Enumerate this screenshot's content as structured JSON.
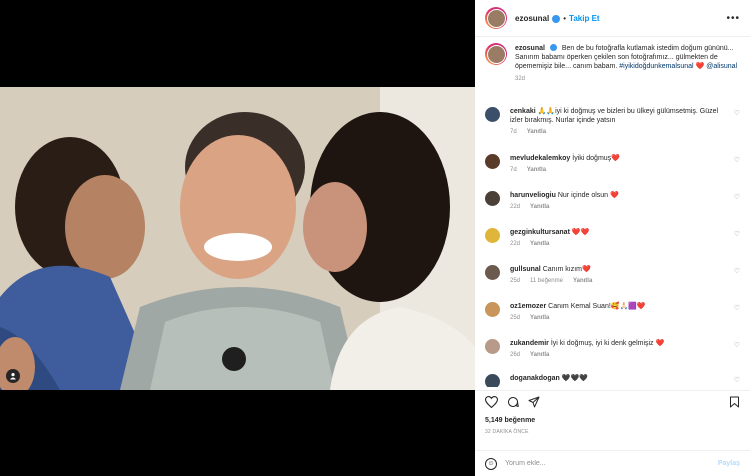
{
  "post": {
    "username": "ezosunal",
    "follow_label": "Takip Et",
    "dot": "•",
    "more": "•••"
  },
  "caption": {
    "username": "ezosunal",
    "text": "Ben de bu fotoğrafla kutlamak istedim doğum gününü... Sanırım babamı öperken çekilen son fotoğrafımız... gülmekten de öpememişiz bile... canım babam.",
    "hashtag": "#iyikidoğdunkemalsunal",
    "heart": "❤️",
    "mention": "@alisunal",
    "time": "32d"
  },
  "comments": [
    {
      "username": "cenkaki",
      "text": "🙏🙏iyi ki doğmuş ve bizleri bu ülkeyi gülümsetmiş. Güzel izler bırakmış. Nurlar içinde yatsın",
      "time": "7d",
      "reply": "Yanıtla",
      "likes": "",
      "avatar_color": "#3c4f6a"
    },
    {
      "username": "mevludekalemkoy",
      "text": "İyiki doğmuş❤️",
      "time": "7d",
      "reply": "Yanıtla",
      "likes": "",
      "avatar_color": "#5a3b2a"
    },
    {
      "username": "harunveliogiu",
      "text": "Nur içinde olsun ❤️",
      "time": "22d",
      "reply": "Yanıtla",
      "likes": "",
      "avatar_color": "#4a4038"
    },
    {
      "username": "gezginkultursanat",
      "text": "❤️❤️",
      "time": "22d",
      "reply": "Yanıtla",
      "likes": "",
      "avatar_color": "#e0b63a"
    },
    {
      "username": "gullsunal",
      "text": "Canım kızım❤️",
      "time": "25d",
      "reply": "Yanıtla",
      "likes": "11 beğenme",
      "avatar_color": "#6d5a4f"
    },
    {
      "username": "oz1emozer",
      "text": "Canım Kemal Suan!🥰🙏🏻🟪❤️",
      "time": "25d",
      "reply": "Yanıtla",
      "likes": "",
      "avatar_color": "#c8955a"
    },
    {
      "username": "zukandemir",
      "text": "İyi ki doğmuş, iyi ki denk gelmişiz ❤️",
      "time": "26d",
      "reply": "Yanıtla",
      "likes": "",
      "avatar_color": "#b89a8a"
    },
    {
      "username": "doganakdogan",
      "text": "🖤🖤🖤",
      "time": "",
      "reply": "",
      "likes": "",
      "avatar_color": "#3a4a5a"
    }
  ],
  "actions": {
    "likes": "5,149 beğenme",
    "ago": "32 DAKİKA ÖNCE"
  },
  "add_comment": {
    "placeholder": "Yorum ekle...",
    "share_label": "Paylaş",
    "emoji": "☺"
  },
  "colors": {
    "accent": "#0095f6",
    "verified": "#3897f0",
    "heart": "#ed4956",
    "muted": "#8e8e8e"
  }
}
